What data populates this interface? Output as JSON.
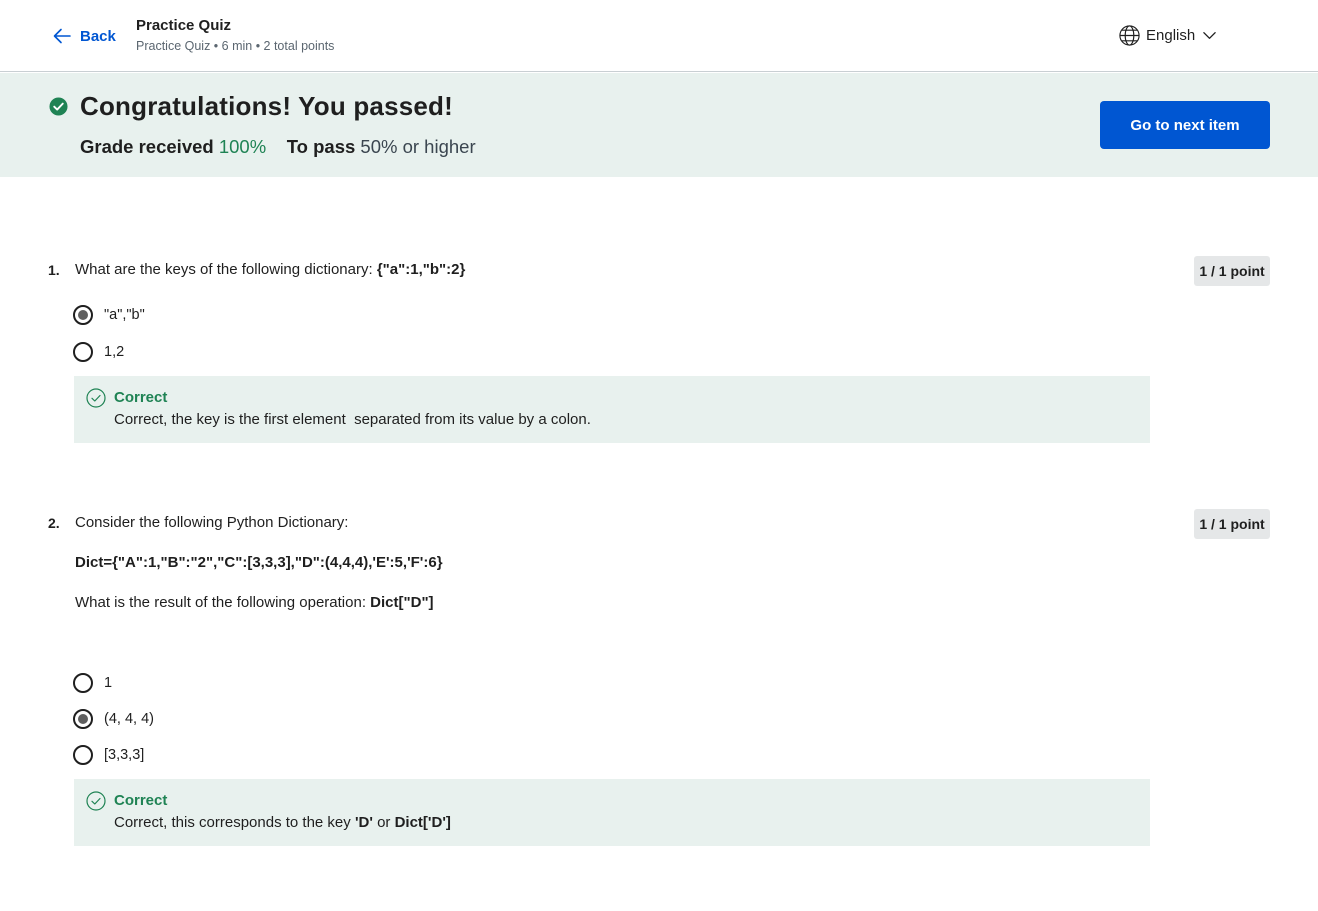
{
  "header": {
    "back_label": "Back",
    "title": "Practice Quiz",
    "subtitle": "Practice Quiz • 6 min • 2 total points",
    "language": "English"
  },
  "banner": {
    "title": "Congratulations! You passed!",
    "grade_label": "Grade received",
    "grade_value": "100%",
    "pass_label": "To pass",
    "pass_value": "50% or higher",
    "next_button": "Go to next item"
  },
  "questions": [
    {
      "number": "1.",
      "text_prefix": "What are the keys of the following dictionary: ",
      "text_code": "{\"a\":1,\"b\":2}",
      "points": "1 / 1 point",
      "options": [
        {
          "label": "\"a\",\"b\"",
          "selected": true
        },
        {
          "label": "1,2",
          "selected": false
        }
      ],
      "feedback": {
        "title": "Correct",
        "text": "Correct, the key is the first element  separated from its value by a colon."
      }
    },
    {
      "number": "2.",
      "text_intro": "Consider the following Python Dictionary:",
      "code_line": "Dict={\"A\":1,\"B\":\"2\",\"C\":[3,3,3],\"D\":(4,4,4),'E':5,'F':6}",
      "text_prefix": "What is the result of the following operation: ",
      "text_code": "Dict[\"D\"]",
      "points": "1 / 1 point",
      "options": [
        {
          "label": "1",
          "selected": false
        },
        {
          "label": "(4, 4, 4)",
          "selected": true
        },
        {
          "label": "[3,3,3]",
          "selected": false
        }
      ],
      "feedback": {
        "title": "Correct",
        "text_prefix": "Correct, this corresponds to the key ",
        "key_code": "'D'",
        "text_mid": " or ",
        "dict_code": "Dict['D']"
      }
    }
  ],
  "colors": {
    "primary": "#0056d2",
    "success": "#1f8354",
    "banner_bg": "#e8f1ee"
  }
}
